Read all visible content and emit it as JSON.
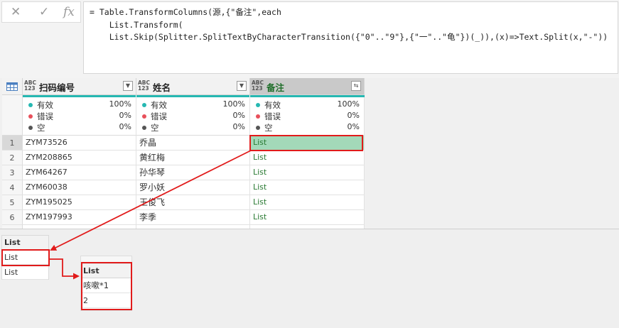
{
  "formula_bar": {
    "cancel_icon": "✕",
    "confirm_icon": "✓",
    "fx_label": "fx",
    "line1": "= Table.TransformColumns(源,{\"备注\",each",
    "line2": "    List.Transform(",
    "line3": "    List.Skip(Splitter.SplitTextByCharacterTransition({\"0\"..\"9\"},{\"一\"..\"龟\"})(_)),(x)=>Text.Split(x,\"-\"))   })"
  },
  "grid": {
    "type_tag_top": "ABC",
    "type_tag_bottom": "123",
    "columns": [
      {
        "name": "扫码编号",
        "active": false
      },
      {
        "name": "姓名",
        "active": false
      },
      {
        "name": "备注",
        "active": true
      }
    ],
    "profile": {
      "labels": [
        "有效",
        "错误",
        "空"
      ],
      "colors": [
        "#26b8b2",
        "#e8505b",
        "#555555"
      ],
      "values": [
        [
          "100%",
          "0%",
          "0%"
        ],
        [
          "100%",
          "0%",
          "0%"
        ],
        [
          "100%",
          "0%",
          "0%"
        ]
      ]
    },
    "rows": [
      {
        "num": "1",
        "code": "ZYM73526",
        "name": "乔晶",
        "note": "List"
      },
      {
        "num": "2",
        "code": "ZYM208865",
        "name": "黄红梅",
        "note": "List"
      },
      {
        "num": "3",
        "code": "ZYM64267",
        "name": "孙华琴",
        "note": "List"
      },
      {
        "num": "4",
        "code": "ZYM60038",
        "name": "罗小妖",
        "note": "List"
      },
      {
        "num": "5",
        "code": "ZYM195025",
        "name": "王俊飞",
        "note": "List"
      },
      {
        "num": "6",
        "code": "ZYM197993",
        "name": "李季",
        "note": "List"
      }
    ]
  },
  "preview_list": {
    "header": "List",
    "items": [
      "List",
      "List"
    ]
  },
  "preview_nested": {
    "header": "List",
    "items": [
      "咳嗽*1",
      "2"
    ]
  }
}
